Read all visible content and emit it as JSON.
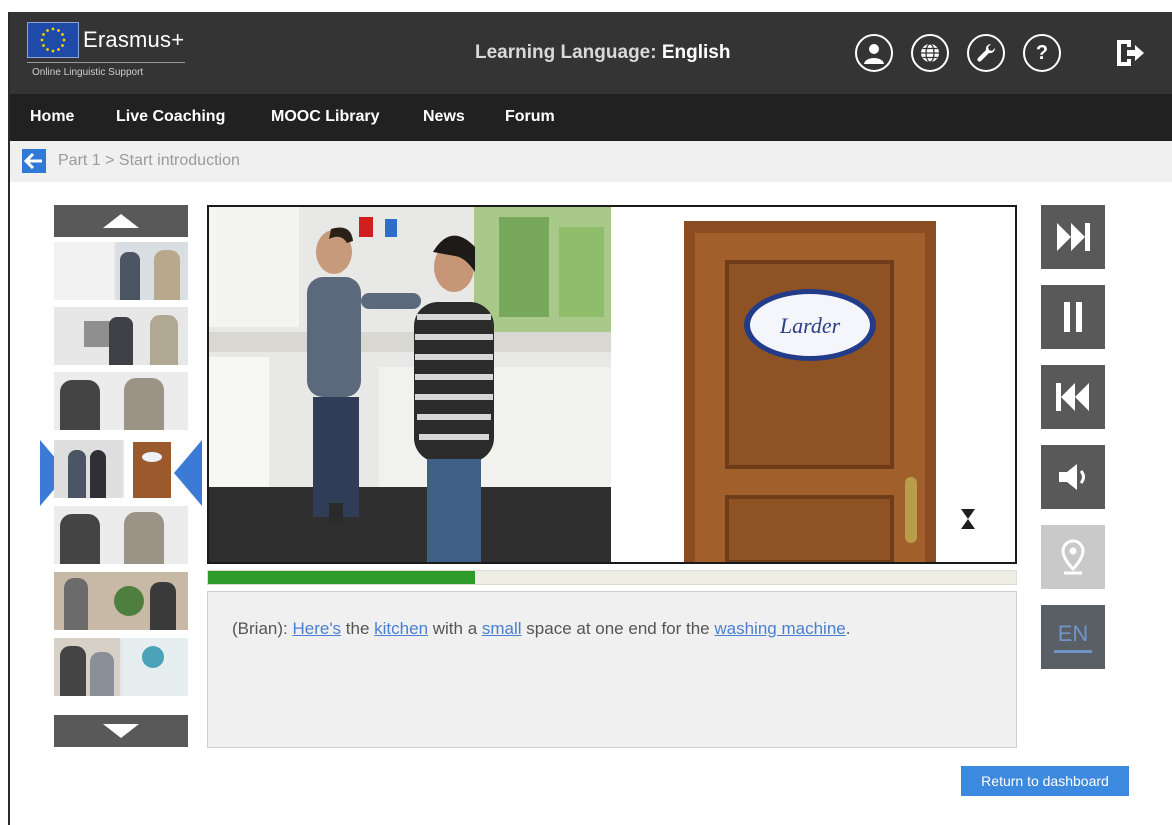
{
  "header": {
    "brand": "Erasmus+",
    "brand_sub": "Online Linguistic Support",
    "learning_label": "Learning Language:",
    "learning_value": "English",
    "icons": [
      "user-icon",
      "globe-icon",
      "wrench-icon",
      "help-icon",
      "logout-icon"
    ],
    "help_glyph": "?"
  },
  "nav": {
    "items": [
      {
        "label": "Home"
      },
      {
        "label": "Live Coaching"
      },
      {
        "label": "MOOC Library"
      },
      {
        "label": "News"
      },
      {
        "label": "Forum"
      }
    ]
  },
  "breadcrumb": {
    "text": "Part 1  >  Start introduction"
  },
  "player": {
    "door_sign": "Larder",
    "progress": 0.33,
    "caption": {
      "speaker": "(Brian):",
      "parts": [
        {
          "text": "Here's",
          "link": true
        },
        {
          "text": " the ",
          "link": false
        },
        {
          "text": "kitchen",
          "link": true
        },
        {
          "text": " with a ",
          "link": false
        },
        {
          "text": "small",
          "link": true
        },
        {
          "text": " space at one end for the ",
          "link": false
        },
        {
          "text": "washing machine",
          "link": true
        },
        {
          "text": ".",
          "link": false
        }
      ]
    }
  },
  "controls": {
    "lang_label": "EN"
  },
  "footer": {
    "return_label": "Return to dashboard"
  },
  "colors": {
    "topbar": "#343434",
    "navbar": "#212121",
    "accent": "#3c8ae0",
    "progress": "#2f9b2a"
  }
}
